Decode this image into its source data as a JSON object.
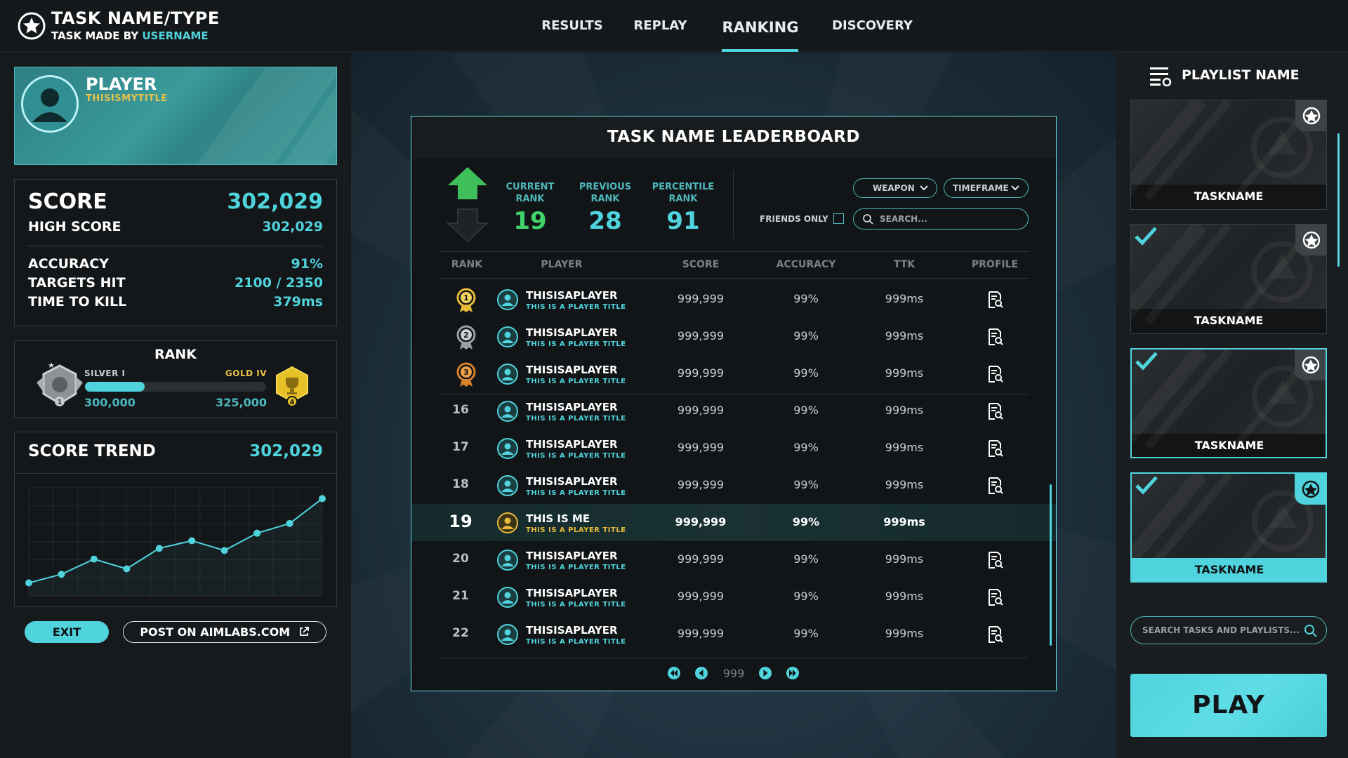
{
  "header": {
    "task_title": "TASK NAME/TYPE",
    "task_made_by": "TASK MADE BY",
    "username": "USERNAME",
    "tabs": [
      {
        "label": "RESULTS"
      },
      {
        "label": "REPLAY"
      },
      {
        "label": "RANKING",
        "active": true
      },
      {
        "label": "DISCOVERY"
      }
    ]
  },
  "player": {
    "name": "PLAYER",
    "title": "THISISMYTITLE"
  },
  "score": {
    "score_label": "SCORE",
    "score_value": "302,029",
    "high_score_label": "HIGH SCORE",
    "high_score_value": "302,029",
    "accuracy_label": "ACCURACY",
    "accuracy_value": "91%",
    "targets_label": "TARGETS HIT",
    "targets_value": "2100 / 2350",
    "ttk_label": "TIME TO KILL",
    "ttk_value": "379ms"
  },
  "rank": {
    "heading": "RANK",
    "current_tier": "SILVER I",
    "next_tier": "GOLD IV",
    "current_points": "300,000",
    "next_points": "325,000",
    "progress": 0.33
  },
  "trend": {
    "label": "SCORE TREND",
    "value": "302,029",
    "points": [
      0.12,
      0.2,
      0.34,
      0.25,
      0.44,
      0.51,
      0.42,
      0.58,
      0.67,
      0.9
    ]
  },
  "actions": {
    "exit_label": "EXIT",
    "post_label": "POST ON AIMLABS.COM"
  },
  "leaderboard": {
    "title": "TASK NAME LEADERBOARD",
    "current_rank_label": "CURRENT\nRANK",
    "current_rank_value": "19",
    "previous_rank_label": "PREVIOUS\nRANK",
    "previous_rank_value": "28",
    "percentile_label": "PERCENTILE\nRANK",
    "percentile_value": "91",
    "weapon_label": "WEAPON",
    "timeframe_label": "TIMEFRAME",
    "friends_only_label": "FRIENDS ONLY",
    "search_placeholder": "SEARCH...",
    "columns": [
      "RANK",
      "PLAYER",
      "SCORE",
      "ACCURACY",
      "TTK",
      "PROFILE"
    ],
    "rows": [
      {
        "rank": "",
        "medal": "1",
        "name": "THISISAPLAYER",
        "title": "THIS IS A PLAYER TITLE",
        "score": "999,999",
        "accuracy": "99%",
        "ttk": "999ms"
      },
      {
        "rank": "",
        "medal": "2",
        "name": "THISISAPLAYER",
        "title": "THIS IS A PLAYER TITLE",
        "score": "999,999",
        "accuracy": "99%",
        "ttk": "999ms"
      },
      {
        "rank": "",
        "medal": "3",
        "name": "THISISAPLAYER",
        "title": "THIS IS A PLAYER TITLE",
        "score": "999,999",
        "accuracy": "99%",
        "ttk": "999ms"
      },
      {
        "rank": "16",
        "name": "THISISAPLAYER",
        "title": "THIS IS A PLAYER TITLE",
        "score": "999,999",
        "accuracy": "99%",
        "ttk": "999ms"
      },
      {
        "rank": "17",
        "name": "THISISAPLAYER",
        "title": "THIS IS A PLAYER TITLE",
        "score": "999,999",
        "accuracy": "99%",
        "ttk": "999ms"
      },
      {
        "rank": "18",
        "name": "THISISAPLAYER",
        "title": "THIS IS A PLAYER TITLE",
        "score": "999,999",
        "accuracy": "99%",
        "ttk": "999ms"
      },
      {
        "rank": "19",
        "me": true,
        "name": "THIS IS ME",
        "title": "THIS IS A PLAYER TITLE",
        "score": "999,999",
        "accuracy": "99%",
        "ttk": "999ms"
      },
      {
        "rank": "20",
        "name": "THISISAPLAYER",
        "title": "THIS IS A PLAYER TITLE",
        "score": "999,999",
        "accuracy": "99%",
        "ttk": "999ms"
      },
      {
        "rank": "21",
        "name": "THISISAPLAYER",
        "title": "THIS IS A PLAYER TITLE",
        "score": "999,999",
        "accuracy": "99%",
        "ttk": "999ms"
      },
      {
        "rank": "22",
        "name": "THISISAPLAYER",
        "title": "THIS IS A PLAYER TITLE",
        "score": "999,999",
        "accuracy": "99%",
        "ttk": "999ms"
      }
    ],
    "page": "999"
  },
  "playlist": {
    "name": "PLAYLIST NAME",
    "tasks": [
      {
        "label": "TASKNAME",
        "checked": false,
        "state": "normal"
      },
      {
        "label": "TASKNAME",
        "checked": true,
        "state": "normal"
      },
      {
        "label": "TASKNAME",
        "checked": true,
        "state": "active"
      },
      {
        "label": "TASKNAME",
        "checked": true,
        "state": "selected"
      }
    ],
    "search_placeholder": "SEARCH TASKS AND PLAYLISTS...",
    "play_label": "PLAY"
  },
  "colors": {
    "accent": "#4fd3dc",
    "gold": "#e8c24a",
    "rank_up": "#3fbf5a"
  }
}
